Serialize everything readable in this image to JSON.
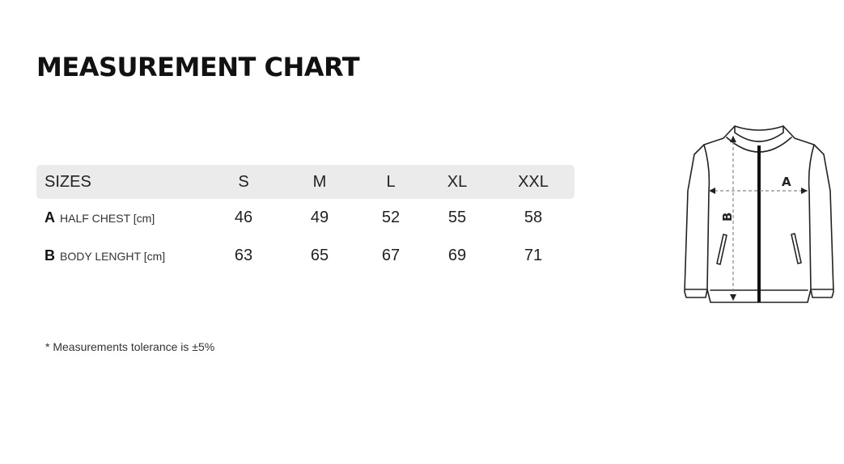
{
  "title": "MEASUREMENT CHART",
  "table": {
    "header_label": "SIZES",
    "sizes": [
      "S",
      "M",
      "L",
      "XL",
      "XXL"
    ],
    "rows": [
      {
        "letter": "A",
        "name": "HALF CHEST [cm]",
        "values": [
          "46",
          "49",
          "52",
          "55",
          "58"
        ]
      },
      {
        "letter": "B",
        "name": "BODY LENGHT [cm]",
        "values": [
          "63",
          "65",
          "67",
          "69",
          "71"
        ]
      }
    ]
  },
  "note": "* Measurements tolerance is ±5%",
  "diagram": {
    "label_a": "A",
    "label_b": "B"
  }
}
